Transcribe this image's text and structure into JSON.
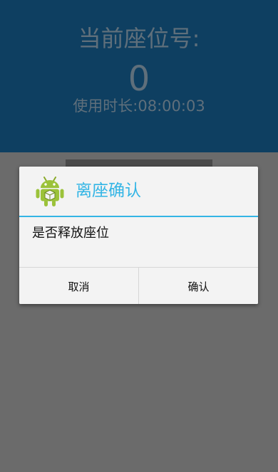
{
  "header": {
    "seat_label": "当前座位号:",
    "seat_number": "0",
    "usage_label": "使用时长:",
    "usage_time": "08:00:03"
  },
  "dialog": {
    "icon": "android-robot-icon",
    "title": "离座确认",
    "message": "是否释放座位",
    "cancel_label": "取消",
    "confirm_label": "确认"
  },
  "colors": {
    "header_bg": "#0e3f61",
    "header_text": "#5f6f7b",
    "overlay_bg": "#6b6b6b",
    "dialog_accent": "#33b5e5",
    "dialog_bg": "#f3f3f3"
  }
}
